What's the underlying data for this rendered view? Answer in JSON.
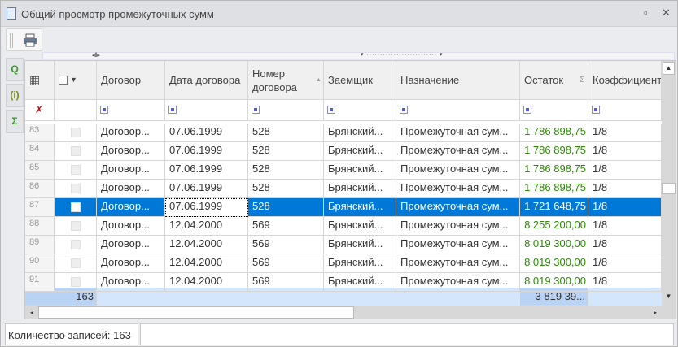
{
  "window": {
    "title": "Общий просмотр промежуточных сумм",
    "maximize_icon": "maximize-icon",
    "close_icon": "close-icon"
  },
  "toolbar": {
    "print_icon": "printer-icon"
  },
  "side_tools": [
    {
      "icon": "search-icon",
      "glyph": "Q",
      "color": "#3a9a2a"
    },
    {
      "icon": "info-icon",
      "glyph": "(i)",
      "color": "#7a8a20"
    },
    {
      "icon": "sigma-icon",
      "glyph": "Σ",
      "color": "#3a9a2a"
    }
  ],
  "grid": {
    "columns": [
      {
        "key": "num",
        "label": ""
      },
      {
        "key": "chk",
        "label": ""
      },
      {
        "key": "contract",
        "label": "Договор"
      },
      {
        "key": "date",
        "label": "Дата договора"
      },
      {
        "key": "number",
        "label": "Номер договора",
        "sort": "ascending"
      },
      {
        "key": "borrower",
        "label": "Заемщик"
      },
      {
        "key": "purpose",
        "label": "Назначение"
      },
      {
        "key": "balance",
        "label": "Остаток",
        "summary": "Σ"
      },
      {
        "key": "coef",
        "label": "Коэффициент"
      }
    ],
    "rows": [
      {
        "num": "83",
        "contract": "Договор...",
        "date": "07.06.1999",
        "number": "528",
        "borrower": "Брянский...",
        "purpose": "Промежуточная  сум...",
        "balance": "1 786 898,75",
        "coef": "1/8"
      },
      {
        "num": "84",
        "contract": "Договор...",
        "date": "07.06.1999",
        "number": "528",
        "borrower": "Брянский...",
        "purpose": "Промежуточная  сум...",
        "balance": "1 786 898,75",
        "coef": "1/8"
      },
      {
        "num": "85",
        "contract": "Договор...",
        "date": "07.06.1999",
        "number": "528",
        "borrower": "Брянский...",
        "purpose": "Промежуточная  сум...",
        "balance": "1 786 898,75",
        "coef": "1/8"
      },
      {
        "num": "86",
        "contract": "Договор...",
        "date": "07.06.1999",
        "number": "528",
        "borrower": "Брянский...",
        "purpose": "Промежуточная  сум...",
        "balance": "1 786 898,75",
        "coef": "1/8"
      },
      {
        "num": "87",
        "contract": "Договор...",
        "date": "07.06.1999",
        "number": "528",
        "borrower": "Брянский...",
        "purpose": "Промежуточная  сум...",
        "balance": "1 721 648,75",
        "coef": "1/8",
        "selected": true
      },
      {
        "num": "88",
        "contract": "Договор...",
        "date": "12.04.2000",
        "number": "569",
        "borrower": "Брянский...",
        "purpose": "Промежуточная  сум...",
        "balance": "8 255 200,00",
        "coef": "1/8"
      },
      {
        "num": "89",
        "contract": "Договор...",
        "date": "12.04.2000",
        "number": "569",
        "borrower": "Брянский...",
        "purpose": "Промежуточная  сум...",
        "balance": "8 019 300,00",
        "coef": "1/8"
      },
      {
        "num": "90",
        "contract": "Договор...",
        "date": "12.04.2000",
        "number": "569",
        "borrower": "Брянский...",
        "purpose": "Промежуточная  сум...",
        "balance": "8 019 300,00",
        "coef": "1/8"
      },
      {
        "num": "91",
        "contract": "Договор...",
        "date": "12.04.2000",
        "number": "569",
        "borrower": "Брянский...",
        "purpose": "Промежуточная  сум...",
        "balance": "8 019 300,00",
        "coef": "1/8"
      }
    ],
    "footer": {
      "count": "163",
      "balance_total": "3 819 39..."
    },
    "balance_color": "#2a8a00",
    "selection_color": "#0078d7"
  },
  "status": {
    "records": "Количество записей: 163"
  }
}
